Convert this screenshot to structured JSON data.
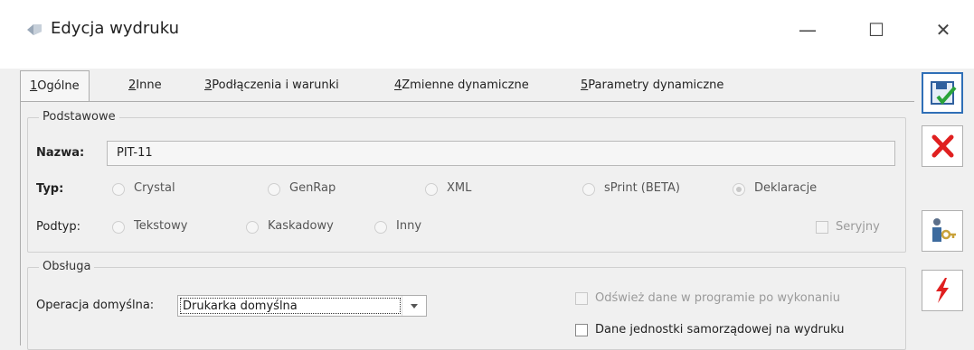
{
  "window": {
    "title": "Edycja wydruku",
    "minimize": "—",
    "maximize": "☐",
    "close": "✕"
  },
  "tabs": [
    {
      "key": "1",
      "label": "Ogólne",
      "active": true
    },
    {
      "key": "2",
      "label": "Inne"
    },
    {
      "key": "3",
      "label": "Podłączenia i warunki"
    },
    {
      "key": "4",
      "label": "Zmienne dynamiczne"
    },
    {
      "key": "5",
      "label": "Parametry dynamiczne"
    }
  ],
  "basic": {
    "legend": "Podstawowe",
    "name_label": "Nazwa:",
    "name_value": "PIT-11",
    "type_label": "Typ:",
    "types": [
      {
        "label": "Crystal",
        "checked": false
      },
      {
        "label": "GenRap",
        "checked": false
      },
      {
        "label": "XML",
        "checked": false
      },
      {
        "label": "sPrint (BETA)",
        "checked": false
      },
      {
        "label": "Deklaracje",
        "checked": true
      }
    ],
    "subtype_label": "Podtyp:",
    "subtypes": [
      {
        "label": "Tekstowy"
      },
      {
        "label": "Kaskadowy"
      },
      {
        "label": "Inny"
      }
    ],
    "serial_label": "Seryjny"
  },
  "handling": {
    "legend": "Obsługa",
    "default_op_label": "Operacja domyślna:",
    "default_op_value": "Drukarka domyślna",
    "refresh_label": "Odśwież dane w programie po wykonaniu",
    "local_gov_label": "Dane jednostki samorządowej na wydruku"
  },
  "colors": {
    "accent": "#2f6fb7",
    "cancel": "#e02020",
    "run": "#e02020"
  }
}
